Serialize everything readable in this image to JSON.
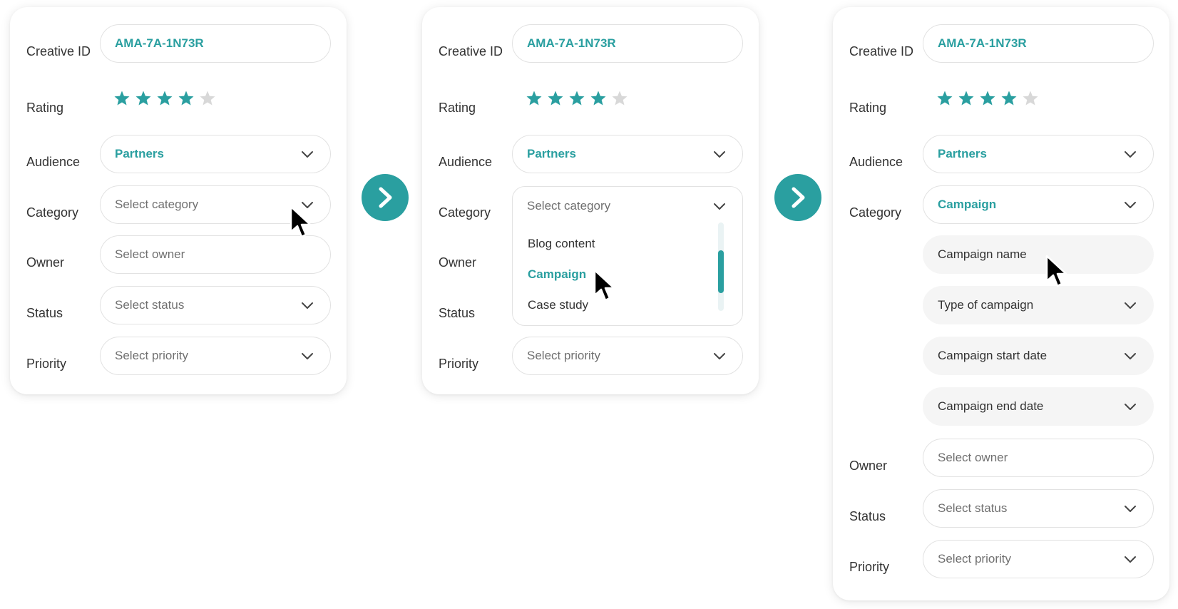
{
  "colors": {
    "accent": "#2a9fa0",
    "star_off": "#d8d8d8",
    "placeholder": "#707070"
  },
  "rating": {
    "value": 4,
    "max": 5
  },
  "panel1": {
    "creative_id_label": "Creative ID",
    "creative_id_value": "AMA-7A-1N73R",
    "rating_label": "Rating",
    "audience_label": "Audience",
    "audience_value": "Partners",
    "category_label": "Category",
    "category_placeholder": "Select category",
    "owner_label": "Owner",
    "owner_placeholder": "Select owner",
    "status_label": "Status",
    "status_placeholder": "Select status",
    "priority_label": "Priority",
    "priority_placeholder": "Select priority"
  },
  "panel2": {
    "creative_id_label": "Creative ID",
    "creative_id_value": "AMA-7A-1N73R",
    "rating_label": "Rating",
    "audience_label": "Audience",
    "audience_value": "Partners",
    "category_label": "Category",
    "category_placeholder": "Select category",
    "category_options": [
      "Blog content",
      "Campaign",
      "Case study"
    ],
    "owner_label": "Owner",
    "status_label": "Status",
    "priority_label": "Priority",
    "priority_placeholder": "Select priority"
  },
  "panel3": {
    "creative_id_label": "Creative ID",
    "creative_id_value": "AMA-7A-1N73R",
    "rating_label": "Rating",
    "audience_label": "Audience",
    "audience_value": "Partners",
    "category_label": "Category",
    "category_value": "Campaign",
    "campaign_name": "Campaign name",
    "campaign_type": "Type of campaign",
    "campaign_start": "Campaign start date",
    "campaign_end": "Campaign end date",
    "owner_label": "Owner",
    "owner_placeholder": "Select owner",
    "status_label": "Status",
    "status_placeholder": "Select status",
    "priority_label": "Priority",
    "priority_placeholder": "Select priority"
  },
  "icons": [
    "star-icon",
    "chevron-down-icon",
    "chevron-right-icon",
    "mouse-cursor-icon"
  ]
}
